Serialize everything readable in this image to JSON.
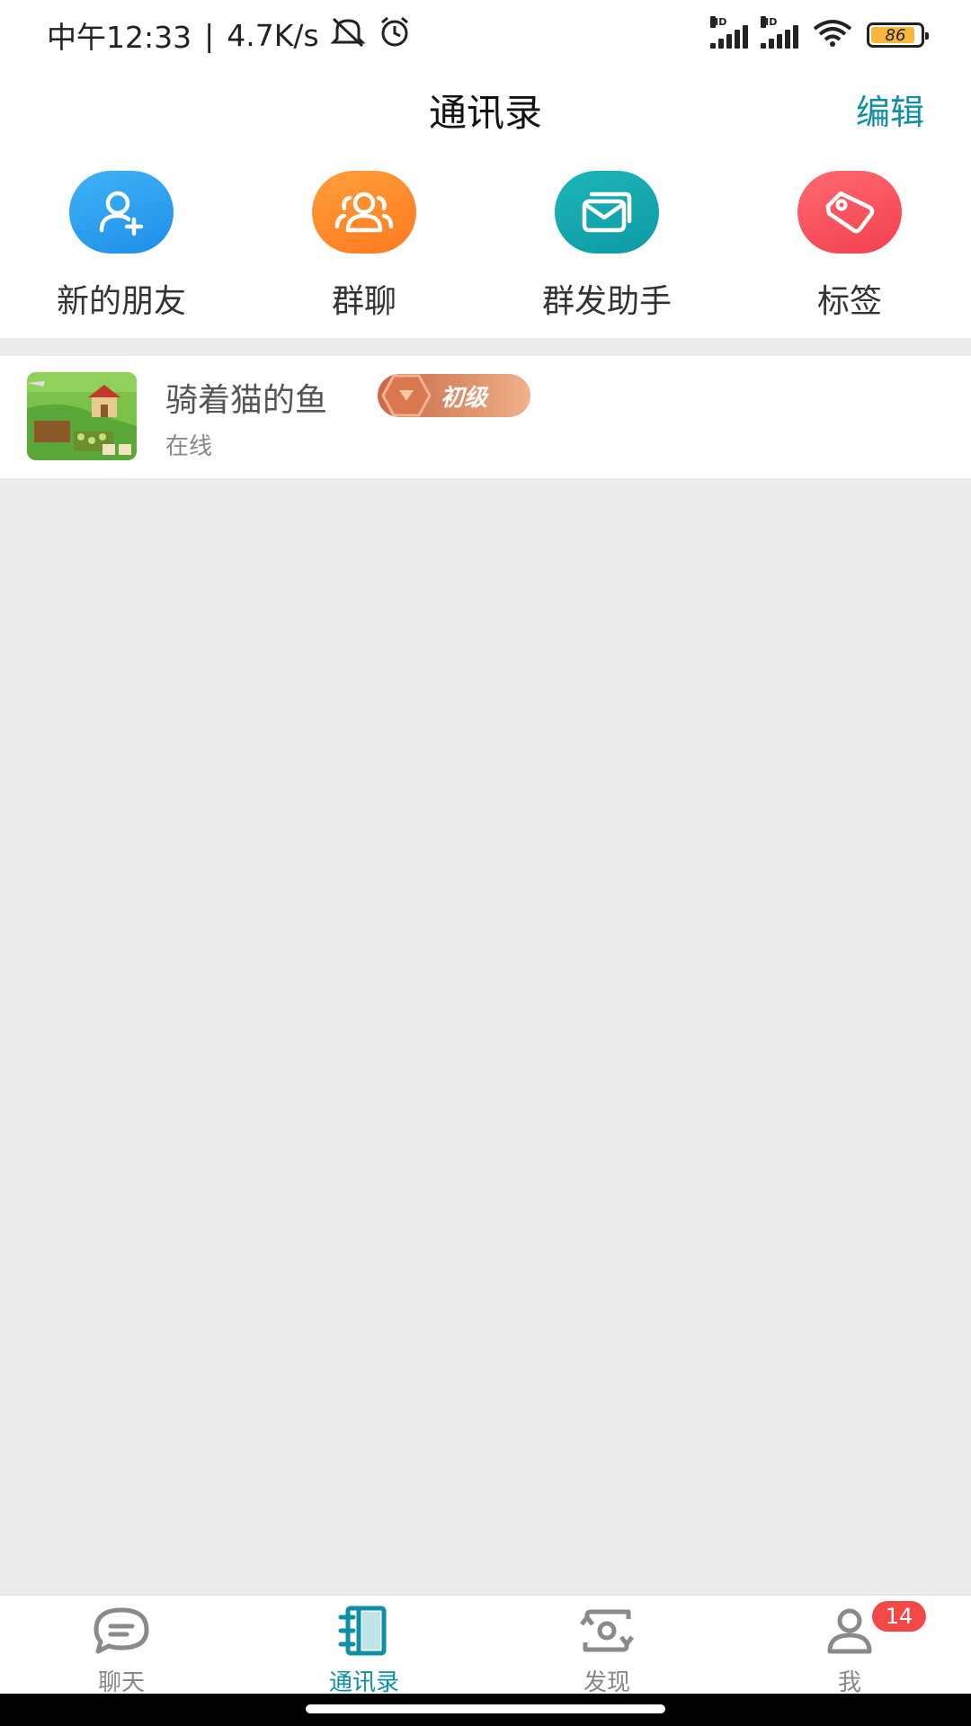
{
  "status_bar": {
    "time": "中午12:33",
    "separator": "|",
    "network_speed": "4.7K/s",
    "battery": "86",
    "icons": [
      "mute-bell-icon",
      "alarm-icon",
      "signal-hd-icon",
      "signal-hd-icon",
      "wifi-icon",
      "battery-icon"
    ]
  },
  "header": {
    "title": "通讯录",
    "edit_label": "编辑"
  },
  "quick_actions": [
    {
      "label": "新的朋友",
      "icon": "add-user-icon",
      "color": "#2f9ef0"
    },
    {
      "label": "群聊",
      "icon": "group-icon",
      "color": "#ff8a2a"
    },
    {
      "label": "群发助手",
      "icon": "mail-stack-icon",
      "color": "#16a5ad"
    },
    {
      "label": "标签",
      "icon": "tag-icon",
      "color": "#f5505e"
    }
  ],
  "contacts": [
    {
      "name": "骑着猫的鱼",
      "level": "初级",
      "status": "在线"
    }
  ],
  "tabbar": {
    "tabs": [
      {
        "label": "聊天",
        "icon": "chat-icon",
        "active": false
      },
      {
        "label": "通讯录",
        "icon": "contacts-book-icon",
        "active": true
      },
      {
        "label": "发现",
        "icon": "discover-icon",
        "active": false
      },
      {
        "label": "我",
        "icon": "user-icon",
        "active": false,
        "badge": "14"
      }
    ]
  }
}
